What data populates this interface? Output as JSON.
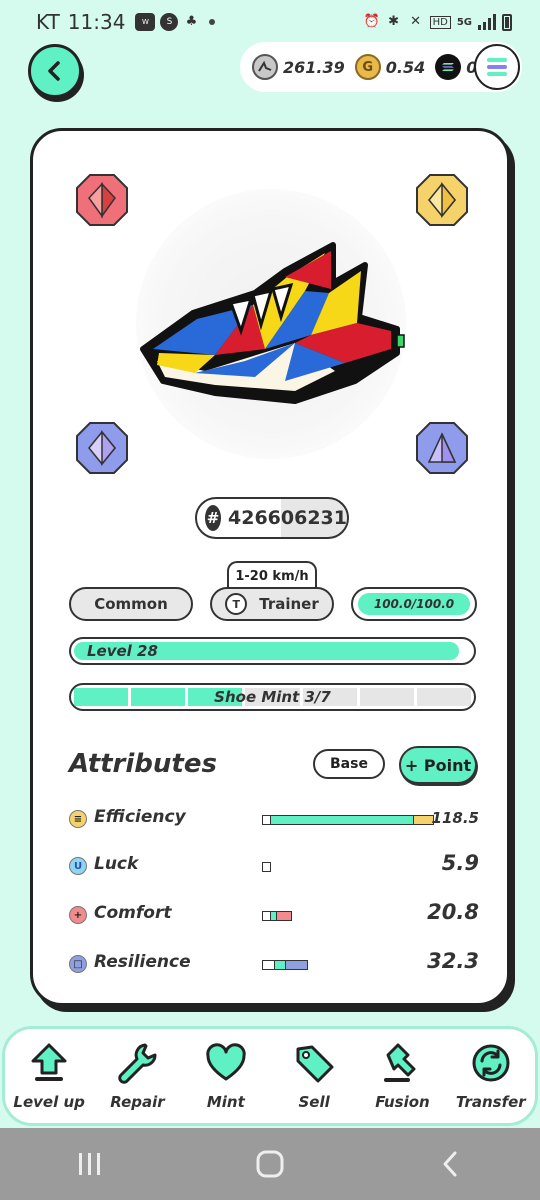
{
  "status_bar": {
    "carrier": "KT",
    "time": "11:34",
    "left_icons": [
      "wear-icon",
      "s-icon",
      "game-icon"
    ],
    "right_icons": [
      "alarm-icon",
      "bluetooth-icon",
      "mute-icon",
      "hd-icon",
      "5g-icon",
      "signal-icon",
      "battery-icon"
    ],
    "hd": "HD",
    "net": "5G"
  },
  "currency": {
    "gst": "261.39",
    "gmt": "0.54",
    "sol": "0"
  },
  "sneaker": {
    "id": "426606231",
    "speed_range": "1-20 km/h",
    "rarity": "Common",
    "type": "Trainer",
    "type_letter": "T",
    "durability": "100.0/100.0",
    "durability_fraction": 1.0,
    "level": "Level 28",
    "level_fraction": 0.97,
    "mint": "Shoe Mint 3/7",
    "mint_used": 3,
    "mint_total": 7
  },
  "attributes": {
    "title": "Attributes",
    "base_label": "Base",
    "point_label": "+ Point",
    "items": [
      {
        "name": "Efficiency",
        "value": "118.5",
        "icon": "efficiency-icon",
        "icon_char": "≡",
        "icon_color": "#f5d36a",
        "bar_color": "#5ff0c3",
        "extra_color": "#f5d36a"
      },
      {
        "name": "Luck",
        "value": "5.9",
        "icon": "luck-icon",
        "icon_char": "U",
        "icon_color": "#8fd4f2",
        "bar_color": "#8fd4f2",
        "extra_color": "#8fd4f2"
      },
      {
        "name": "Comfort",
        "value": "20.8",
        "icon": "comfort-icon",
        "icon_char": "+",
        "icon_color": "#f28b8b",
        "bar_color": "#5ff0c3",
        "extra_color": "#f28b8b"
      },
      {
        "name": "Resilience",
        "value": "32.3",
        "icon": "resilience-icon",
        "icon_char": "□",
        "icon_color": "#8fa0e0",
        "bar_color": "#5ff0c3",
        "extra_color": "#8fa0e0"
      }
    ]
  },
  "nav": {
    "items": [
      {
        "label": "Level up",
        "icon": "level-up-icon"
      },
      {
        "label": "Repair",
        "icon": "wrench-icon"
      },
      {
        "label": "Mint",
        "icon": "heart-icon"
      },
      {
        "label": "Sell",
        "icon": "tag-icon"
      },
      {
        "label": "Fusion",
        "icon": "hammer-icon"
      },
      {
        "label": "Transfer",
        "icon": "transfer-icon"
      }
    ]
  },
  "colors": {
    "accent": "#5ff0c3",
    "background": "#d4fbee",
    "gem_red": "#f0707a",
    "gem_yellow": "#f5d36a",
    "gem_blue": "#8f9cec"
  }
}
